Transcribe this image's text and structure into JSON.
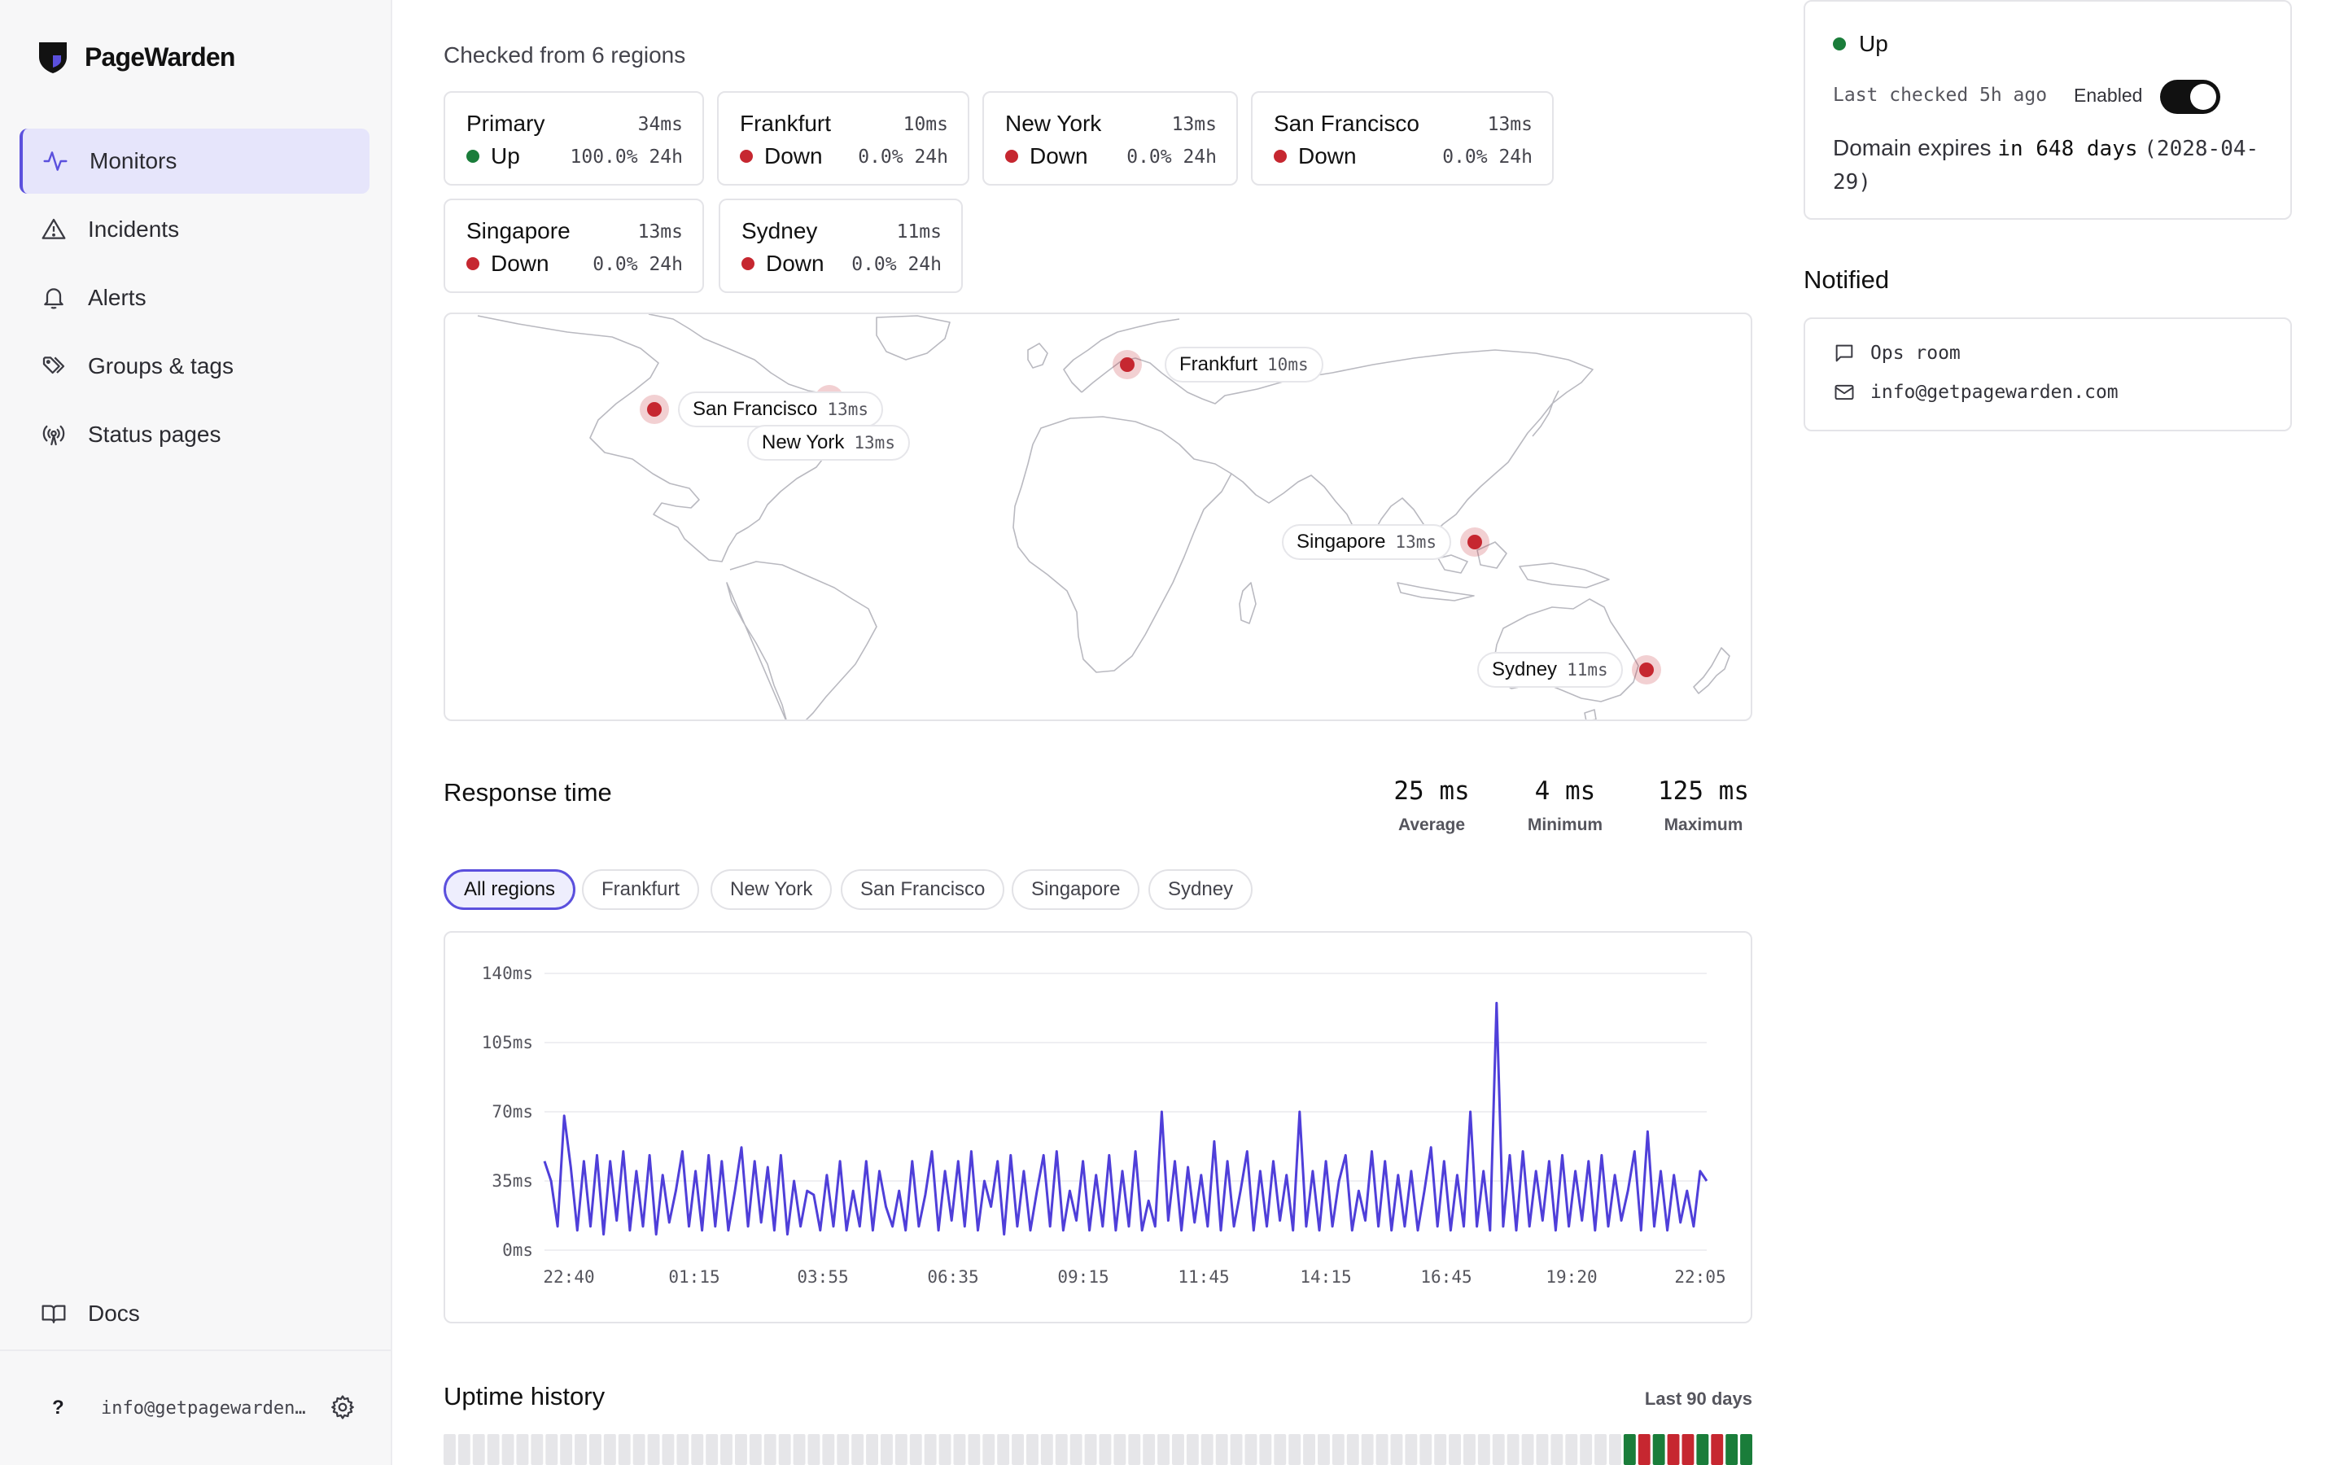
{
  "app": {
    "name": "PageWarden"
  },
  "sidebar": {
    "items": [
      {
        "label": "Monitors",
        "active": true
      },
      {
        "label": "Incidents"
      },
      {
        "label": "Alerts"
      },
      {
        "label": "Groups & tags"
      },
      {
        "label": "Status pages"
      }
    ],
    "docs_label": "Docs",
    "user": {
      "help": "?",
      "email": "info@getpagewarden.com"
    }
  },
  "regions": {
    "caption": "Checked from 6 regions",
    "cards": [
      {
        "name": "Primary",
        "latency": "34ms",
        "status": "Up",
        "uptime": "100.0% 24h"
      },
      {
        "name": "Frankfurt",
        "latency": "10ms",
        "status": "Down",
        "uptime": "0.0% 24h"
      },
      {
        "name": "New York",
        "latency": "13ms",
        "status": "Down",
        "uptime": "0.0% 24h"
      },
      {
        "name": "San Francisco",
        "latency": "13ms",
        "status": "Down",
        "uptime": "0.0% 24h"
      },
      {
        "name": "Singapore",
        "latency": "13ms",
        "status": "Down",
        "uptime": "0.0% 24h"
      },
      {
        "name": "Sydney",
        "latency": "11ms",
        "status": "Down",
        "uptime": "0.0% 24h"
      }
    ]
  },
  "map": {
    "labels": [
      {
        "name": "Frankfurt",
        "ms": "10ms"
      },
      {
        "name": "San Francisco",
        "ms": "13ms"
      },
      {
        "name": "New York",
        "ms": "13ms"
      },
      {
        "name": "Singapore",
        "ms": "13ms"
      },
      {
        "name": "Sydney",
        "ms": "11ms"
      }
    ]
  },
  "response_time": {
    "title": "Response time",
    "stats": [
      {
        "value": "25 ms",
        "label": "Average"
      },
      {
        "value": "4 ms",
        "label": "Minimum"
      },
      {
        "value": "125 ms",
        "label": "Maximum"
      }
    ],
    "filters": [
      "All regions",
      "Frankfurt",
      "New York",
      "San Francisco",
      "Singapore",
      "Sydney"
    ],
    "active_filter": "All regions"
  },
  "chart_data": {
    "type": "line",
    "title": "",
    "xlabel": "",
    "ylabel": "",
    "ylim": [
      0,
      140
    ],
    "y_ticks": [
      "0ms",
      "35ms",
      "70ms",
      "105ms",
      "140ms"
    ],
    "x_ticks": [
      "22:40",
      "01:15",
      "03:55",
      "06:35",
      "09:15",
      "11:45",
      "14:15",
      "16:45",
      "19:20",
      "22:05"
    ],
    "series": [
      {
        "values": [
          45,
          35,
          12,
          68,
          42,
          10,
          45,
          12,
          48,
          8,
          45,
          15,
          50,
          10,
          40,
          12,
          48,
          8,
          38,
          14,
          30,
          50,
          12,
          40,
          10,
          48,
          12,
          45,
          10,
          30,
          52,
          12,
          45,
          14,
          42,
          10,
          48,
          8,
          35,
          12,
          30,
          28,
          10,
          38,
          12,
          45,
          10,
          30,
          12,
          45,
          10,
          40,
          22,
          12,
          30,
          10,
          45,
          12,
          28,
          50,
          10,
          40,
          15,
          45,
          12,
          50,
          10,
          35,
          22,
          45,
          8,
          48,
          12,
          40,
          10,
          30,
          48,
          12,
          50,
          10,
          30,
          15,
          45,
          10,
          38,
          12,
          48,
          10,
          40,
          12,
          50,
          10,
          25,
          12,
          70,
          15,
          45,
          10,
          42,
          14,
          38,
          12,
          55,
          10,
          45,
          12,
          30,
          50,
          10,
          40,
          12,
          45,
          15,
          38,
          10,
          70,
          12,
          40,
          10,
          45,
          12,
          35,
          48,
          10,
          30,
          15,
          50,
          12,
          45,
          10,
          38,
          12,
          40,
          10,
          30,
          52,
          12,
          45,
          10,
          38,
          12,
          70,
          12,
          40,
          10,
          125,
          12,
          48,
          10,
          50,
          12,
          40,
          15,
          45,
          10,
          48,
          12,
          40,
          15,
          45,
          10,
          48,
          12,
          38,
          15,
          30,
          50,
          10,
          60,
          12,
          40,
          10,
          38,
          14,
          30,
          12,
          40,
          35
        ]
      }
    ]
  },
  "uptime_history": {
    "title": "Uptime history",
    "range": "Last 90 days",
    "days": [
      "none",
      "none",
      "none",
      "none",
      "none",
      "none",
      "none",
      "none",
      "none",
      "none",
      "none",
      "none",
      "none",
      "none",
      "none",
      "none",
      "none",
      "none",
      "none",
      "none",
      "none",
      "none",
      "none",
      "none",
      "none",
      "none",
      "none",
      "none",
      "none",
      "none",
      "none",
      "none",
      "none",
      "none",
      "none",
      "none",
      "none",
      "none",
      "none",
      "none",
      "none",
      "none",
      "none",
      "none",
      "none",
      "none",
      "none",
      "none",
      "none",
      "none",
      "none",
      "none",
      "none",
      "none",
      "none",
      "none",
      "none",
      "none",
      "none",
      "none",
      "none",
      "none",
      "none",
      "none",
      "none",
      "none",
      "none",
      "none",
      "none",
      "none",
      "none",
      "none",
      "none",
      "none",
      "none",
      "none",
      "none",
      "none",
      "none",
      "none",
      "none",
      "up",
      "down",
      "up",
      "down",
      "down",
      "up",
      "down",
      "up",
      "up"
    ]
  },
  "monitor_status": {
    "status": "Up",
    "last_checked": "Last checked 5h ago",
    "enabled_label": "Enabled",
    "enabled": true,
    "domain_prefix": "Domain expires",
    "domain_in": "in 648 days",
    "domain_date": "(2028-04-29)"
  },
  "notified": {
    "title": "Notified",
    "items": [
      {
        "icon": "chat-icon",
        "label": "Ops room"
      },
      {
        "icon": "mail-icon",
        "label": "info@getpagewarden.com"
      }
    ]
  },
  "colors": {
    "accent": "#5b50dd",
    "up": "#1a7d3a",
    "down": "#c62730"
  }
}
